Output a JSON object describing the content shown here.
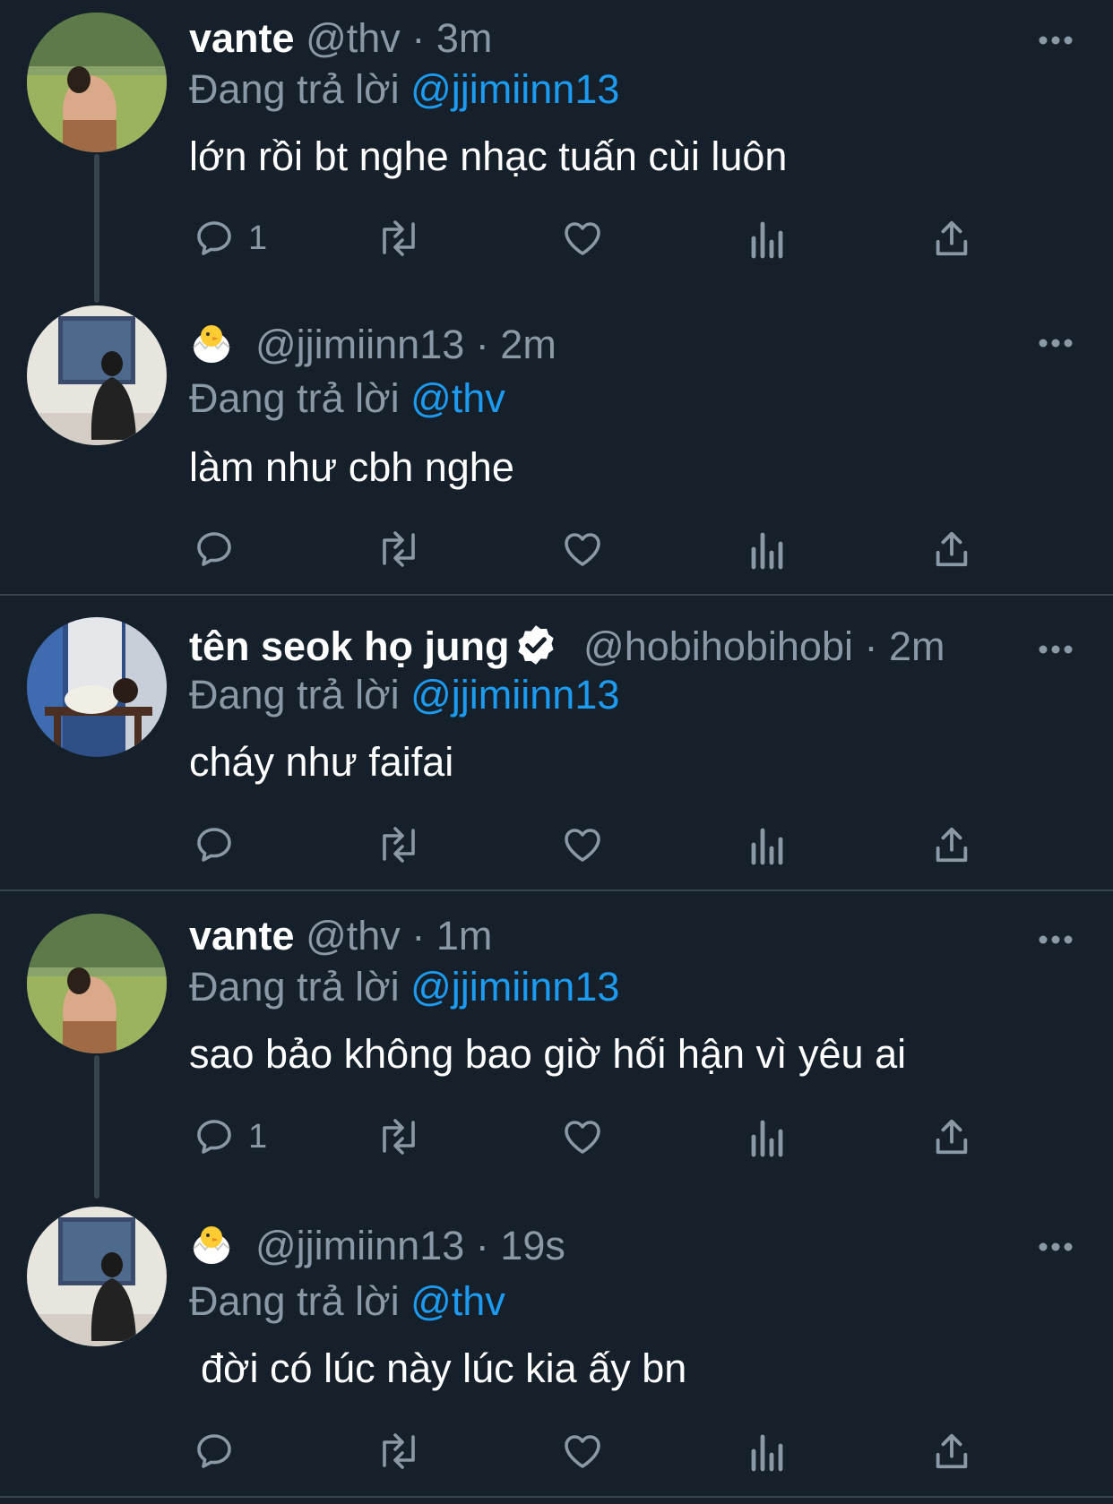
{
  "tweets": [
    {
      "name": "vante",
      "handle": "@thv",
      "separator": "·",
      "time": "3m",
      "reply_prefix": "Đang trả lời",
      "reply_target": "@jjimiinn13",
      "text": "lớn rồi bt nghe nhạc tuấn cùi luôn",
      "reply_count": "1",
      "verified": false
    },
    {
      "name": "🐣",
      "handle": "@jjimiinn13",
      "separator": "·",
      "time": "2m",
      "reply_prefix": "Đang trả lời",
      "reply_target": "@thv",
      "text": "làm như cbh nghe",
      "reply_count": "",
      "verified": false
    },
    {
      "name": "tên seok họ jung",
      "handle": "@hobihobihobi",
      "separator": "·",
      "time": "2m",
      "reply_prefix": "Đang trả lời",
      "reply_target": "@jjimiinn13",
      "text": "cháy như faifai",
      "reply_count": "",
      "verified": true
    },
    {
      "name": "vante",
      "handle": "@thv",
      "separator": "·",
      "time": "1m",
      "reply_prefix": "Đang trả lời",
      "reply_target": "@jjimiinn13",
      "text": "sao bảo không bao giờ hối hận vì yêu ai",
      "reply_count": "1",
      "verified": false
    },
    {
      "name": "🐣",
      "handle": "@jjimiinn13",
      "separator": "·",
      "time": "19s",
      "reply_prefix": "Đang trả lời",
      "reply_target": "@thv",
      "text": "đời có lúc này lúc kia ấy bn",
      "reply_count": "",
      "verified": false
    }
  ],
  "colors": {
    "background": "#15202b",
    "text_primary": "#ffffff",
    "text_secondary": "#8b98a5",
    "link": "#1d9bf0",
    "divider": "#38444d"
  },
  "icons": [
    "reply-icon",
    "retweet-icon",
    "like-icon",
    "analytics-icon",
    "share-icon",
    "more-icon",
    "verified-icon"
  ]
}
